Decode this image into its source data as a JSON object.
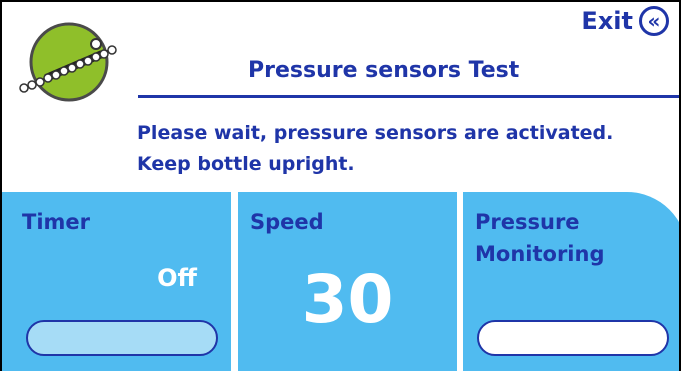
{
  "header": {
    "exit_label": "Exit",
    "exit_icon": "double-chevron-left-icon",
    "title": "Pressure sensors Test",
    "logo_icon": "bottle-sensor-logo-icon"
  },
  "message": {
    "line1": "Please wait, pressure sensors are activated.",
    "line2": "Keep bottle upright."
  },
  "panels": {
    "timer": {
      "label": "Timer",
      "value": "Off"
    },
    "speed": {
      "label": "Speed",
      "value": "30"
    },
    "pressure": {
      "label_line1": "Pressure",
      "label_line2": "Monitoring"
    }
  },
  "colors": {
    "brand_blue": "#1f35a8",
    "panel_blue": "#50bbf0",
    "logo_green": "#8fbf2a",
    "timer_pill": "#a6dcf6"
  }
}
